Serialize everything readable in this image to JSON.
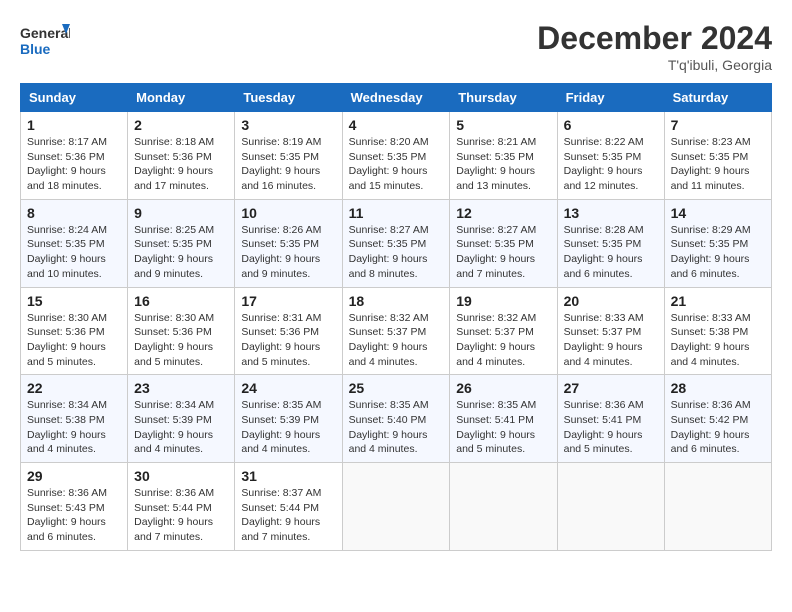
{
  "header": {
    "logo_line1": "General",
    "logo_line2": "Blue",
    "month": "December 2024",
    "location": "T'q'ibuli, Georgia"
  },
  "weekdays": [
    "Sunday",
    "Monday",
    "Tuesday",
    "Wednesday",
    "Thursday",
    "Friday",
    "Saturday"
  ],
  "weeks": [
    [
      {
        "day": "1",
        "sunrise": "8:17 AM",
        "sunset": "5:36 PM",
        "daylight": "9 hours and 18 minutes."
      },
      {
        "day": "2",
        "sunrise": "8:18 AM",
        "sunset": "5:36 PM",
        "daylight": "9 hours and 17 minutes."
      },
      {
        "day": "3",
        "sunrise": "8:19 AM",
        "sunset": "5:35 PM",
        "daylight": "9 hours and 16 minutes."
      },
      {
        "day": "4",
        "sunrise": "8:20 AM",
        "sunset": "5:35 PM",
        "daylight": "9 hours and 15 minutes."
      },
      {
        "day": "5",
        "sunrise": "8:21 AM",
        "sunset": "5:35 PM",
        "daylight": "9 hours and 13 minutes."
      },
      {
        "day": "6",
        "sunrise": "8:22 AM",
        "sunset": "5:35 PM",
        "daylight": "9 hours and 12 minutes."
      },
      {
        "day": "7",
        "sunrise": "8:23 AM",
        "sunset": "5:35 PM",
        "daylight": "9 hours and 11 minutes."
      }
    ],
    [
      {
        "day": "8",
        "sunrise": "8:24 AM",
        "sunset": "5:35 PM",
        "daylight": "9 hours and 10 minutes."
      },
      {
        "day": "9",
        "sunrise": "8:25 AM",
        "sunset": "5:35 PM",
        "daylight": "9 hours and 9 minutes."
      },
      {
        "day": "10",
        "sunrise": "8:26 AM",
        "sunset": "5:35 PM",
        "daylight": "9 hours and 9 minutes."
      },
      {
        "day": "11",
        "sunrise": "8:27 AM",
        "sunset": "5:35 PM",
        "daylight": "9 hours and 8 minutes."
      },
      {
        "day": "12",
        "sunrise": "8:27 AM",
        "sunset": "5:35 PM",
        "daylight": "9 hours and 7 minutes."
      },
      {
        "day": "13",
        "sunrise": "8:28 AM",
        "sunset": "5:35 PM",
        "daylight": "9 hours and 6 minutes."
      },
      {
        "day": "14",
        "sunrise": "8:29 AM",
        "sunset": "5:35 PM",
        "daylight": "9 hours and 6 minutes."
      }
    ],
    [
      {
        "day": "15",
        "sunrise": "8:30 AM",
        "sunset": "5:36 PM",
        "daylight": "9 hours and 5 minutes."
      },
      {
        "day": "16",
        "sunrise": "8:30 AM",
        "sunset": "5:36 PM",
        "daylight": "9 hours and 5 minutes."
      },
      {
        "day": "17",
        "sunrise": "8:31 AM",
        "sunset": "5:36 PM",
        "daylight": "9 hours and 5 minutes."
      },
      {
        "day": "18",
        "sunrise": "8:32 AM",
        "sunset": "5:37 PM",
        "daylight": "9 hours and 4 minutes."
      },
      {
        "day": "19",
        "sunrise": "8:32 AM",
        "sunset": "5:37 PM",
        "daylight": "9 hours and 4 minutes."
      },
      {
        "day": "20",
        "sunrise": "8:33 AM",
        "sunset": "5:37 PM",
        "daylight": "9 hours and 4 minutes."
      },
      {
        "day": "21",
        "sunrise": "8:33 AM",
        "sunset": "5:38 PM",
        "daylight": "9 hours and 4 minutes."
      }
    ],
    [
      {
        "day": "22",
        "sunrise": "8:34 AM",
        "sunset": "5:38 PM",
        "daylight": "9 hours and 4 minutes."
      },
      {
        "day": "23",
        "sunrise": "8:34 AM",
        "sunset": "5:39 PM",
        "daylight": "9 hours and 4 minutes."
      },
      {
        "day": "24",
        "sunrise": "8:35 AM",
        "sunset": "5:39 PM",
        "daylight": "9 hours and 4 minutes."
      },
      {
        "day": "25",
        "sunrise": "8:35 AM",
        "sunset": "5:40 PM",
        "daylight": "9 hours and 4 minutes."
      },
      {
        "day": "26",
        "sunrise": "8:35 AM",
        "sunset": "5:41 PM",
        "daylight": "9 hours and 5 minutes."
      },
      {
        "day": "27",
        "sunrise": "8:36 AM",
        "sunset": "5:41 PM",
        "daylight": "9 hours and 5 minutes."
      },
      {
        "day": "28",
        "sunrise": "8:36 AM",
        "sunset": "5:42 PM",
        "daylight": "9 hours and 6 minutes."
      }
    ],
    [
      {
        "day": "29",
        "sunrise": "8:36 AM",
        "sunset": "5:43 PM",
        "daylight": "9 hours and 6 minutes."
      },
      {
        "day": "30",
        "sunrise": "8:36 AM",
        "sunset": "5:44 PM",
        "daylight": "9 hours and 7 minutes."
      },
      {
        "day": "31",
        "sunrise": "8:37 AM",
        "sunset": "5:44 PM",
        "daylight": "9 hours and 7 minutes."
      },
      null,
      null,
      null,
      null
    ]
  ]
}
